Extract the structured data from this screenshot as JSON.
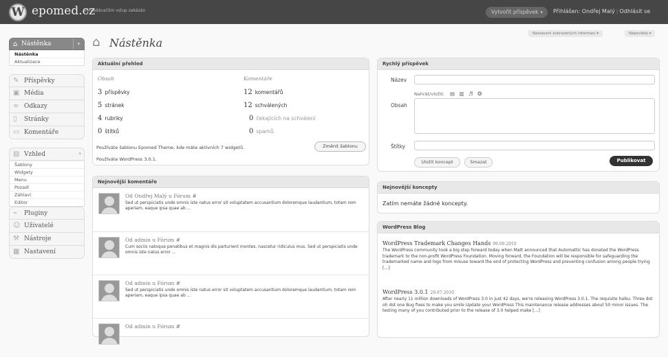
{
  "topbar": {
    "logo": "W",
    "site_title": "epomed.cz",
    "tagline": "Vyhledávačům vstup zakázán",
    "favorite": "Vytvořit příspěvek",
    "favorite_arrow": "▾",
    "logged_in": "Přihlášen: Ondřej Malý",
    "logout": "Odhlásit se"
  },
  "screen_options": "Nastavení zobrazených informací ▾",
  "help": "Nápověda ▾",
  "sidebar": {
    "dashboard": {
      "label": "Nástěnka",
      "toggle": "▾",
      "sub": [
        "Nástěnka",
        "Aktualizace"
      ]
    },
    "group1": [
      "Příspěvky",
      "Média",
      "Odkazy",
      "Stránky",
      "Komentáře"
    ],
    "appearance": {
      "label": "Vzhled",
      "toggle": "▾",
      "sub": [
        "Šablony",
        "Widgety",
        "Menu",
        "Pozadí",
        "Záhlaví",
        "Editor"
      ]
    },
    "group2": [
      "Pluginy",
      "Uživatelé",
      "Nástroje",
      "Nastavení"
    ]
  },
  "page_title": "Nástěnka",
  "overview": {
    "title": "Aktuální přehled",
    "col_content": "Obsah",
    "col_comments": "Komentáře",
    "content": [
      {
        "n": "3",
        "label": "příspěvky"
      },
      {
        "n": "5",
        "label": "stránek"
      },
      {
        "n": "4",
        "label": "rubriky"
      },
      {
        "n": "0",
        "label": "štítků"
      }
    ],
    "comments": [
      {
        "n": "12",
        "label": "komentářů"
      },
      {
        "n": "12",
        "label": "schválených"
      },
      {
        "n": "0",
        "label": "čekajících na schválení"
      },
      {
        "n": "0",
        "label": "spamů"
      }
    ],
    "theme_line": "Používáte šablonu Epomed Theme, kde máte aktivních 7 widgetů.",
    "change_theme": "Změnit šablonu",
    "wp_line": "Používáte WordPress 3.0.1."
  },
  "recent_comments": {
    "title": "Nejnovější komentáře",
    "items": [
      {
        "by": "Od Ondřej Malý u Fórum #",
        "text": "Sed ut perspiciatis unde omnis iste natus error sit voluptatem accusantium doloremque laudantium, totam rem aperiam, eaque ipsa quae ab ..."
      },
      {
        "by": "Od admin u Fórum #",
        "text": "Cum sociis natoque penatibus et magnis dis parturient montes, nascetur ridiculus mus. Sed ut perspiciatis unde omnis iste natus error ..."
      },
      {
        "by": "Od admin u Fórum #",
        "text": "Sed ut perspiciatis unde omnis iste natus error sit voluptatem accusantium doloremque laudantium, totam rem aperiam, eaque ipsa quae ab ..."
      },
      {
        "by": "Od admin u Fórum #",
        "text": ""
      }
    ]
  },
  "quick_post": {
    "title": "Rychlý příspěvek",
    "name_label": "Název",
    "content_label": "Obsah",
    "upload_label": "Nahrát/vložit:",
    "upload_icons": "▤ ▥ ♬ ✪",
    "tags_label": "Štítky",
    "save_draft": "Uložit koncept",
    "reset": "Smazat",
    "publish": "Publikovat"
  },
  "drafts": {
    "title": "Nejnovější koncepty",
    "empty": "Zatím nemáte žádné koncepty."
  },
  "blog": {
    "title": "WordPress Blog",
    "posts": [
      {
        "title": "WordPress Trademark Changes Hands",
        "date": "09.09.2010",
        "text": "The WordPress community took a big step forward today when Matt announced that Automattic has donated the WordPress trademark to the non-profit WordPress Foundation. Moving forward, the Foundation will be responsible for safeguarding the trademarked name and logo from misuse toward the end of protecting WordPress and preventing confusion among people trying […]"
      },
      {
        "title": "WordPress 3.0.1",
        "date": "29.07.2010",
        "text": "After nearly 11 million downloads of WordPress 3.0 in just 42 days, we're releasing WordPress 3.0.1. The requisite haiku: Three dot oh dot one Bug fixes to make you smile Update your WordPress This maintenance release addresses about 50 minor issues. The testing many of you contributed prior to the release of 3.0 helped make […]"
      }
    ]
  }
}
